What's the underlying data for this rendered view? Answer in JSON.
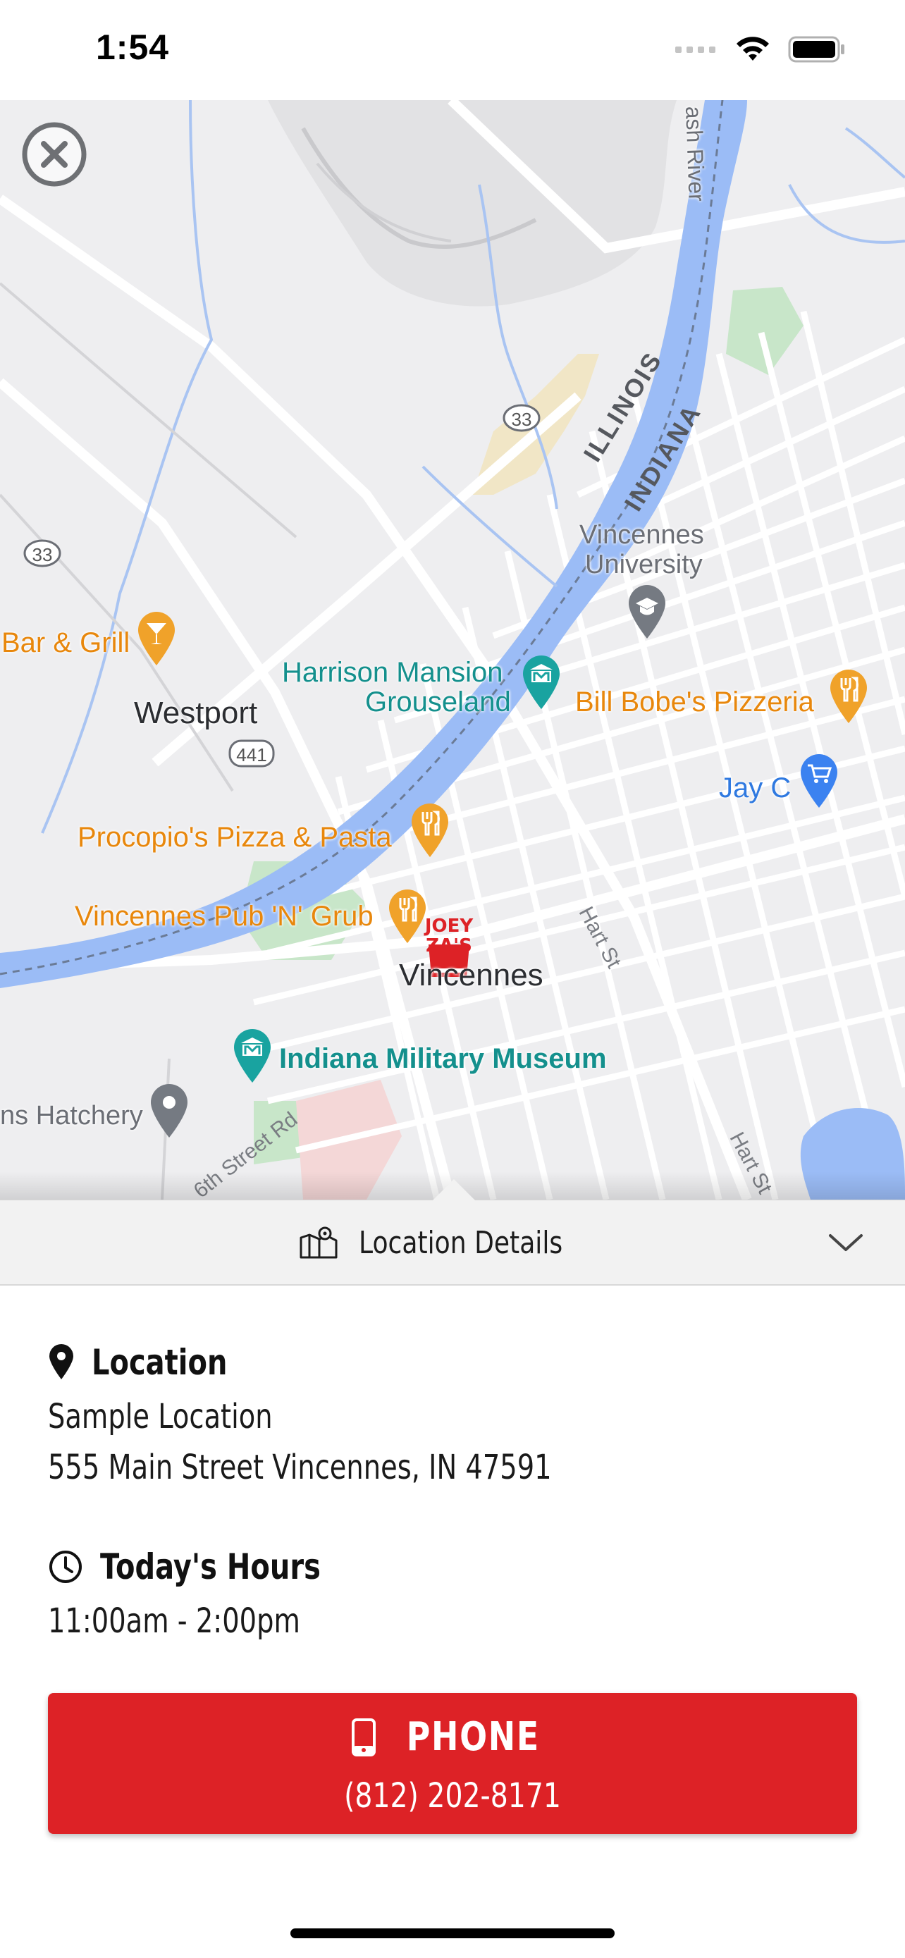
{
  "status_bar": {
    "time": "1:54"
  },
  "map": {
    "labels": {
      "bar_grill": "Bar & Grill",
      "westport": "Westport",
      "route_441": "441",
      "route_33_a": "33",
      "route_33_b": "33",
      "illinois": "ILLINOIS",
      "indiana": "INDIANA",
      "vincennes_university": [
        "Vincennes",
        "University"
      ],
      "harrison_mansion": [
        "Harrison Mansion",
        "Grouseland"
      ],
      "bill_bobes": "Bill Bobe's Pizzeria",
      "jay_c": "Jay C",
      "procopios": "Procopio's Pizza & Pasta",
      "vincennes_pub": "Vincennes Pub 'N' Grub",
      "vincennes": "Vincennes",
      "indiana_military_museum": "Indiana Military Museum",
      "hatchery": "ns Hatchery",
      "wabash_river": "ash River",
      "hart_st_a": "Hart St",
      "hart_st_b": "Hart St",
      "street_rd": "6th Street Rd",
      "joey_zas_logo": "JOEY ZA'S"
    }
  },
  "details": {
    "header_title": "Location Details",
    "location_heading": "Location",
    "location_name": "Sample Location",
    "location_address": "555 Main Street Vincennes, IN 47591",
    "hours_heading": "Today's Hours",
    "hours_value": "11:00am - 2:00pm",
    "phone_label": "PHONE",
    "phone_number": "(812) 202-8171"
  },
  "colors": {
    "accent_red": "#dd2226",
    "poi_orange": "#f0a22a",
    "poi_teal": "#19a3a0",
    "water_blue": "#9bbcf6"
  }
}
